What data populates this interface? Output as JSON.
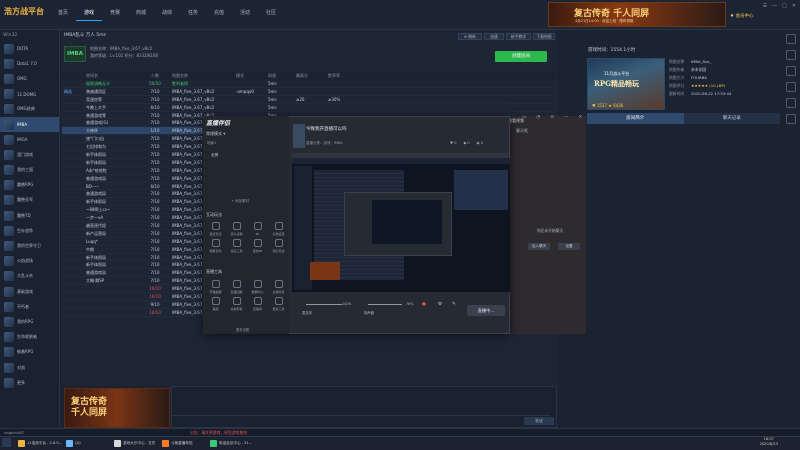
{
  "app": {
    "logo_text": "浩方战平台",
    "nav": [
      "首页",
      "游戏",
      "竞赛",
      "商城",
      "战绩",
      "任务",
      "充值",
      "活动",
      "社区"
    ],
    "active_nav_index": 1,
    "window_controls": [
      "☰",
      "—",
      "□",
      "✕"
    ],
    "vip_text": "会员中心"
  },
  "top_banner": {
    "title": "复古传奇 千人同屏",
    "subtitle": "4月21日14:00 · 欢迎上线 · 限时领取"
  },
  "sidebar": {
    "header": "Win32",
    "items": [
      {
        "label": "DOTA"
      },
      {
        "label": "Dota1 7.0"
      },
      {
        "label": "OMG"
      },
      {
        "label": "11.DOMG"
      },
      {
        "label": "OMG经典"
      },
      {
        "label": "IMBA",
        "active": true
      },
      {
        "label": "IMGA"
      },
      {
        "label": "澄门游戏"
      },
      {
        "label": "我的三国"
      },
      {
        "label": "魔兽RPG"
      },
      {
        "label": "魔兽亚军"
      },
      {
        "label": "魔兽TD"
      },
      {
        "label": "生存战争"
      },
      {
        "label": "我的世界守卫"
      },
      {
        "label": "火焰战场"
      },
      {
        "label": "大乱斗杂"
      },
      {
        "label": "基础游戏"
      },
      {
        "label": "不朽者"
      },
      {
        "label": "我的RPG"
      },
      {
        "label": "生命收割者"
      },
      {
        "label": "偷着RPG"
      },
      {
        "label": "对战"
      },
      {
        "label": "更多"
      }
    ]
  },
  "room": {
    "breadcrumb": "IMBA乱斗 万人 5ms",
    "logo": "IMBA",
    "info_line1": "地图名称：IMBA_five_3.67_vBc2",
    "info_line2": "我的等级：Lv.102   积分：8132/8180",
    "create_button": "创建房间",
    "tools": [
      "⟳ 刷新",
      "创建",
      "新手教学",
      "下载地图"
    ]
  },
  "table": {
    "headers": [
      "",
      "房间名",
      "人数",
      "地图名称",
      "模式",
      "网速",
      "最高分",
      "胜率率"
    ],
    "rows": [
      {
        "tag": "",
        "name": "极限流畅无卡",
        "count": "50/50",
        "map": "胜利者榜",
        "mode": "",
        "ping": "5ms",
        "score": "",
        "rate": "",
        "count_class": "c-green",
        "name_class": "c-green"
      },
      {
        "tag": "精选",
        "name": "普遍通用区",
        "count": "7/10",
        "map": "IMBA_five_3.67_vBc2",
        "mode": "-ampqo0",
        "ping": "5ms",
        "score": "",
        "rate": ""
      },
      {
        "tag": "",
        "name": "竞速房等",
        "count": "7/10",
        "map": "IMBA_five_3.67_vBc2",
        "mode": "",
        "ping": "5ms",
        "score": "≥20",
        "rate": "≥30%"
      },
      {
        "tag": "",
        "name": "今晚上大手",
        "count": "6/10",
        "map": "IMBA_five_3.67_vBc2",
        "mode": "",
        "ping": "5ms",
        "score": "",
        "rate": ""
      },
      {
        "tag": "",
        "name": "普通游戏等",
        "count": "7/10",
        "map": "IMBA_five_3.67_vBc2",
        "mode": "",
        "ping": "5ms",
        "score": "",
        "rate": ""
      },
      {
        "tag": "",
        "name": "普通游戏(G)",
        "count": "7/10",
        "map": "IMBA_five_3.67_vBc2",
        "mode": "",
        "ping": "5ms",
        "score": "",
        "rate": ""
      },
      {
        "tag": "",
        "name": "大神杯",
        "count": "1/10",
        "map": "IMBA_five_3.67_vBc2",
        "mode": "",
        "ping": "",
        "score": "",
        "rate": "",
        "selected": true
      },
      {
        "tag": "",
        "name": "旅*门口出",
        "count": "7/10",
        "map": "IMBA_five_3.67_vBc2",
        "mode": "",
        "ping": "",
        "score": "",
        "rate": ""
      },
      {
        "tag": "",
        "name": "七旧排和为",
        "count": "7/10",
        "map": "IMBA_five_3.67_vBc2",
        "mode": "",
        "ping": "",
        "score": "",
        "rate": ""
      },
      {
        "tag": "",
        "name": "新手体照局",
        "count": "7/10",
        "map": "IMBA_five_3.67_vBc2",
        "mode": "",
        "ping": "",
        "score": "",
        "rate": ""
      },
      {
        "tag": "",
        "name": "新手体照局",
        "count": "7/10",
        "map": "IMBA_five_3.67_vBc2",
        "mode": "",
        "ping": "",
        "score": "",
        "rate": ""
      },
      {
        "tag": "",
        "name": "A米*哈他牧",
        "count": "7/10",
        "map": "IMBA_five_3.67_vBc2",
        "mode": "",
        "ping": "",
        "score": "",
        "rate": ""
      },
      {
        "tag": "",
        "name": "普通游戏局",
        "count": "7/10",
        "map": "IMBA_five_3.67_vBc2",
        "mode": "",
        "ping": "",
        "score": "",
        "rate": ""
      },
      {
        "tag": "",
        "name": "BD-----",
        "count": "6/10",
        "map": "IMBA_five_3.67_vBc2",
        "mode": "",
        "ping": "",
        "score": "",
        "rate": ""
      },
      {
        "tag": "",
        "name": "普通游戏局",
        "count": "7/10",
        "map": "IMBA_five_3.67_vBc2",
        "mode": "",
        "ping": "",
        "score": "",
        "rate": ""
      },
      {
        "tag": "",
        "name": "新手体照局",
        "count": "7/10",
        "map": "IMBA_five_3.67_vBc2",
        "mode": "",
        "ping": "",
        "score": "",
        "rate": ""
      },
      {
        "tag": "",
        "name": "~88啊上cc~",
        "count": "7/10",
        "map": "IMBA_five_3.67_vBc2",
        "mode": "",
        "ping": "",
        "score": "",
        "rate": ""
      },
      {
        "tag": "",
        "name": "一步一vA",
        "count": "7/10",
        "map": "IMBA_five_3.67_vBc2",
        "mode": "",
        "ping": "",
        "score": "",
        "rate": ""
      },
      {
        "tag": "",
        "name": "越直逐代组",
        "count": "7/10",
        "map": "IMBA_five_3.67_vBc2",
        "mode": "",
        "ping": "",
        "score": "",
        "rate": ""
      },
      {
        "tag": "",
        "name": "新产运营局",
        "count": "7/10",
        "map": "IMBA_five_3.67_vBc2",
        "mode": "",
        "ping": "",
        "score": "",
        "rate": ""
      },
      {
        "tag": "",
        "name": "Luqq*",
        "count": "7/10",
        "map": "IMBA_five_3.67_vBc2",
        "mode": "",
        "ping": "",
        "score": "",
        "rate": ""
      },
      {
        "tag": "",
        "name": "中期",
        "count": "7/10",
        "map": "IMBA_five_3.67_vBc2",
        "mode": "",
        "ping": "",
        "score": "",
        "rate": ""
      },
      {
        "tag": "",
        "name": "新手体照局",
        "count": "7/10",
        "map": "IMBA_five_3.67_vBc2",
        "mode": "",
        "ping": "",
        "score": "",
        "rate": ""
      },
      {
        "tag": "",
        "name": "新手体照局",
        "count": "7/10",
        "map": "IMBA_five_3.67_vBc2",
        "mode": "",
        "ping": "",
        "score": "",
        "rate": ""
      },
      {
        "tag": "",
        "name": "普通游戏局",
        "count": "7/10",
        "map": "IMBA_five_3.67_vBc2",
        "mode": "-ampqo0",
        "ping": "5ms",
        "score": "",
        "rate": ""
      },
      {
        "tag": "",
        "name": "大略·鹅SP",
        "count": "7/10",
        "map": "IMBA_five_3.67_vBc2",
        "mode": "-ampqo0",
        "ping": "5ms",
        "score": "≥30",
        "rate": "≥3%"
      },
      {
        "tag": "",
        "name": "",
        "count": "10/10",
        "map": "IMBA_five_3.67_vBc2",
        "mode": "",
        "ping": "5ms",
        "score": "",
        "rate": "",
        "count_class": "c-red"
      },
      {
        "tag": "",
        "name": "",
        "count": "10/10",
        "map": "IMBA_five_3.67_vBc2",
        "mode": "",
        "ping": "5ms",
        "score": "",
        "rate": "",
        "count_class": "c-red"
      },
      {
        "tag": "",
        "name": "",
        "count": "9/10",
        "map": "IMBA_five_3.67_vBc2",
        "mode": "",
        "ping": "",
        "score": "",
        "rate": ""
      },
      {
        "tag": "",
        "name": "",
        "count": "10/10",
        "map": "IMBA_five_3.67_vBc2",
        "mode": "",
        "ping": "",
        "score": "",
        "rate": "",
        "count_class": "c-red"
      }
    ]
  },
  "bottom_banner": {
    "title_line1": "复古传奇",
    "title_line2": "千人同屏"
  },
  "chat": {
    "send_label": "发送"
  },
  "status": {
    "text": "公告：请文明游戏，祝您游戏愉快",
    "user": "uagoin467"
  },
  "right_panel": {
    "title": "游戏时间：1554.1小时",
    "game_card_sub": "11月战斗平台",
    "game_card_title": "RPG精品畅玩",
    "game_card_stats": "♥ 1527  ★ 6436",
    "info": [
      {
        "k": "地图名称",
        "v": "IMBA_five_"
      },
      {
        "k": "地图作者",
        "v": "未本花园"
      },
      {
        "k": "地图大小",
        "v": "FOURBA"
      },
      {
        "k": "地图评分",
        "v": "★★★★★ (10,LBP)"
      },
      {
        "k": "更新时间",
        "v": "2020-08-22 17:53:44"
      }
    ],
    "tabs": [
      "房间简介",
      "聊天记录"
    ],
    "active_tab": 0,
    "notice": "你还未开始聊天",
    "buttons": [
      "加入聊天",
      "设置"
    ]
  },
  "live_window": {
    "logo": "直播伴侣",
    "mode": "常规模式 ▾",
    "mode_tabs": "场景1",
    "item": "全屏",
    "add": "+ 添加素材",
    "section_interact": "互动玩法",
    "interact_items": [
      "连麦玩法",
      "观众点歌",
      "PK",
      "礼物设置",
      "弹幕互动",
      "连麦工具",
      "连线PK",
      "观众玩法"
    ],
    "section_tools": "直播工具",
    "tool_items": [
      "开播提醒",
      "直播回放",
      "数据中心",
      "主播任务",
      "美颜",
      "虚拟形象",
      "直播间",
      "更多工具"
    ],
    "more": "更多设置",
    "title": "今晚我开直播可以吗",
    "subtitle": "直播分类：游戏 · IMBA",
    "stats": [
      "0",
      "0",
      "0"
    ],
    "mic_label": "麦克风",
    "mic_value": "142%",
    "speaker_label": "扬声器",
    "speaker_value": "76%",
    "go_live": "直播中..."
  },
  "partial_dialog": {
    "label": "聊天框",
    "title": "观看视频"
  },
  "taskbar": {
    "items": [
      {
        "label": "11浩战平台 - 2.6.0..."
      },
      {
        "label": "QQ"
      },
      {
        "label": "游戏大厅中心 - 文件"
      },
      {
        "label": "斗鱼直播伴侣"
      },
      {
        "label": "电话会议中心 - 51..."
      }
    ],
    "time": "16:07",
    "date": "2020/8/23"
  },
  "colors": {
    "accent": "#3aa0ff",
    "create": "#2db84d",
    "selected_row": "#2c4568",
    "full_room": "#e25555",
    "banner_gold": "#ffd27a"
  }
}
